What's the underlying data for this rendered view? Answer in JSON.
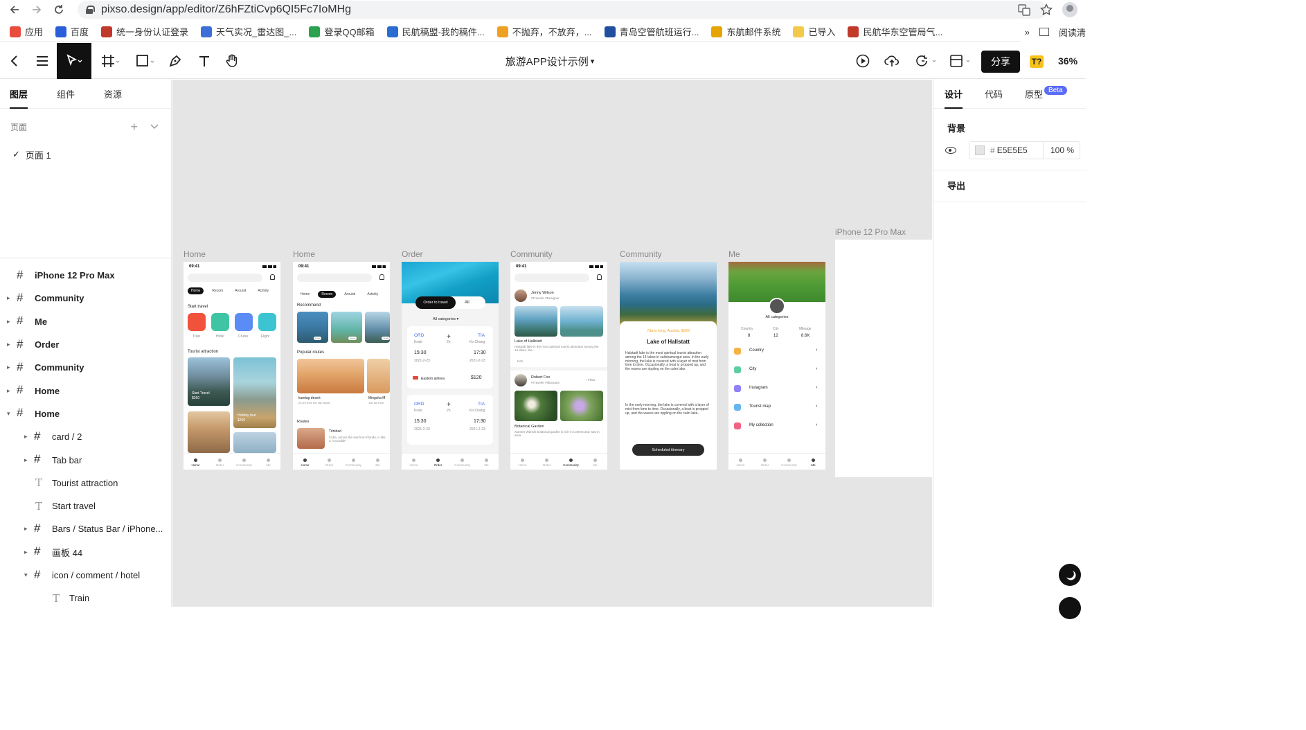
{
  "browser": {
    "url": "pixso.design/app/editor/Z6hFZtiCvp6QI5Fc7IoMHg",
    "bookmarks": [
      "应用",
      "百度",
      "统一身份认证登录",
      "天气实况_雷达图_...",
      "登录QQ邮箱",
      "民航稿盟-我的稿件...",
      "不抛弃，不放弃，...",
      "青岛空管航班运行...",
      "东航邮件系统",
      "已导入",
      "民航华东空管局气..."
    ],
    "bookmark_colors": [
      "#e74c3c",
      "#2b5fd9",
      "#c0392b",
      "#3d6fd8",
      "#2ca14f",
      "#2a6ccf",
      "#f0a020",
      "#1f4f9e",
      "#e6a400",
      "#f3c94a",
      "#c0392b"
    ],
    "overflow": "»",
    "reading_list": "阅读清"
  },
  "toolbar": {
    "file_title": "旅游APP设计示例",
    "title_caret": "▾",
    "share_label": "分享",
    "badge": "T?",
    "zoom": "36%"
  },
  "left_panel": {
    "tabs": [
      "图层",
      "组件",
      "资源"
    ],
    "pages_label": "页面",
    "pages": [
      "页面 1"
    ],
    "layers": [
      {
        "label": "iPhone 12 Pro Max",
        "level": 0,
        "caret": "",
        "type": "frame",
        "bold": true
      },
      {
        "label": "Community",
        "level": 0,
        "caret": "▸",
        "type": "frame",
        "bold": true
      },
      {
        "label": "Me",
        "level": 0,
        "caret": "▸",
        "type": "frame",
        "bold": true
      },
      {
        "label": "Order",
        "level": 0,
        "caret": "▸",
        "type": "frame",
        "bold": true
      },
      {
        "label": "Community",
        "level": 0,
        "caret": "▸",
        "type": "frame",
        "bold": true
      },
      {
        "label": "Home",
        "level": 0,
        "caret": "▸",
        "type": "frame",
        "bold": true
      },
      {
        "label": "Home",
        "level": 0,
        "caret": "▾",
        "type": "frame",
        "bold": true
      },
      {
        "label": "card / 2",
        "level": 1,
        "caret": "▸",
        "type": "frame",
        "bold": false
      },
      {
        "label": "Tab bar",
        "level": 1,
        "caret": "▸",
        "type": "frame",
        "bold": false
      },
      {
        "label": "Tourist attraction",
        "level": 1,
        "caret": "",
        "type": "text",
        "bold": false
      },
      {
        "label": "Start travel",
        "level": 1,
        "caret": "",
        "type": "text",
        "bold": false
      },
      {
        "label": "Bars / Status Bar / iPhone...",
        "level": 1,
        "caret": "▸",
        "type": "frame",
        "bold": false
      },
      {
        "label": "画板 44",
        "level": 1,
        "caret": "▸",
        "type": "frame",
        "bold": false
      },
      {
        "label": "icon / comment / hotel",
        "level": 1,
        "caret": "▾",
        "type": "frame",
        "bold": false
      },
      {
        "label": "Train",
        "level": 2,
        "caret": "",
        "type": "text",
        "bold": false
      }
    ]
  },
  "canvas": {
    "frame_labels": [
      "Home",
      "Home",
      "Order",
      "Community",
      "Community",
      "Me",
      "iPhone 12 Pro Max"
    ],
    "home1": {
      "time": "09:41",
      "tabs": [
        "Home",
        "Recom",
        "Around",
        "Activity"
      ],
      "start_travel": "Start travel",
      "categories": [
        "Train",
        "Hotel",
        "Cruise",
        "Flight"
      ],
      "category_colors": [
        "#f0523b",
        "#3fc5a3",
        "#5b8cf5",
        "#3cc4d2"
      ],
      "tourist_attraction": "Tourist attraction",
      "card1": "Start Travel",
      "card1_price": "$260",
      "card2": "Holiday tour",
      "card2_price": "$260",
      "tabbar": [
        "Home",
        "Order",
        "Community",
        "Me"
      ]
    },
    "home2": {
      "time": "09:41",
      "tabs": [
        "Home",
        "Recom",
        "Around",
        "Activity"
      ],
      "recommend": "Recommend",
      "tags": [
        "Koh",
        "York",
        "York"
      ],
      "popular": "Popular routes",
      "route1": "kumtag desert",
      "route1_sub": "20 km from the city center",
      "route2": "Mingsha M",
      "route2_sub": "100 km from",
      "routes": "Routes",
      "route3": "Trinidad",
      "route3_sub": "Cuba, across the sea from Florida, is like a \"crocodile\"",
      "tabbar": [
        "Home",
        "Order",
        "Community",
        "Me"
      ]
    },
    "order": {
      "btn_primary": "Order to travel",
      "btn_all": "All",
      "all_categories": "All categories ▾",
      "from": "ORD",
      "to": "TIA",
      "from_city": "Krabi",
      "to_city": "Ko Chang",
      "duration": "2h",
      "dep": "15:30",
      "arr": "17:30",
      "date": "2021-2-23",
      "airline": "Eastern airlines",
      "price": "$120",
      "tabbar": [
        "Home",
        "Order",
        "Community",
        "Me"
      ]
    },
    "community1": {
      "time": "09:41",
      "user1": "Jenny Wilson",
      "user1_tags": "#Traveler  #Designer",
      "post1_title": "Lake of Hallstatt",
      "post1_body": "Halstadt lake is the most spiritual tourist attraction among the 14 lakes. the...",
      "post1_tag": "Koh",
      "user2": "Robert Fox",
      "user2_tags": "#Traveler  #Illustrator",
      "follow": "+ Fllow",
      "post2_title": "Botanical Garden",
      "post2_body": "Xiamen Wanshi botanical garden is rich in content and vast in area.",
      "post2_tag": "Koh",
      "tabbar": [
        "Home",
        "Order",
        "Community",
        "Me"
      ]
    },
    "community2": {
      "subtitle": "7days long, Austria, $999",
      "title": "Lake of Hallstatt",
      "para1": "Halstadt lake is the most spiritual tourist attraction among the 14 lakes in saltskamergut area. In the early morning, the lake is covered with a layer of mist from time to time. Occasionally, a boat is propped up, and the waves are rippling on the calm lake.",
      "para2": "In the early morning, the lake is covered with a layer of mist from time to time. Occasionally, a boat is propped up, and the waves are rippling on the calm lake.",
      "button": "Scheduled itinerary"
    },
    "me": {
      "all_categories": "All categories",
      "stats": [
        {
          "label": "Country",
          "value": "8"
        },
        {
          "label": "City",
          "value": "12"
        },
        {
          "label": "Mileage",
          "value": "8.6K"
        }
      ],
      "menu": [
        "Country",
        "City",
        "Instagram",
        "Tourist map",
        "My collection"
      ],
      "menu_colors": [
        "#f5a623",
        "#3fc58f",
        "#7b6cf6",
        "#4aa8f0",
        "#f0476c"
      ],
      "tabbar": [
        "Home",
        "Order",
        "Community",
        "Me"
      ]
    }
  },
  "right_panel": {
    "tabs": [
      "设计",
      "代码",
      "原型"
    ],
    "beta": "Beta",
    "background_label": "背景",
    "bg_hex": "E5E5E5",
    "bg_opacity": "100 %",
    "export_label": "导出",
    "canvas_bg_color": "#e5e5e5"
  }
}
